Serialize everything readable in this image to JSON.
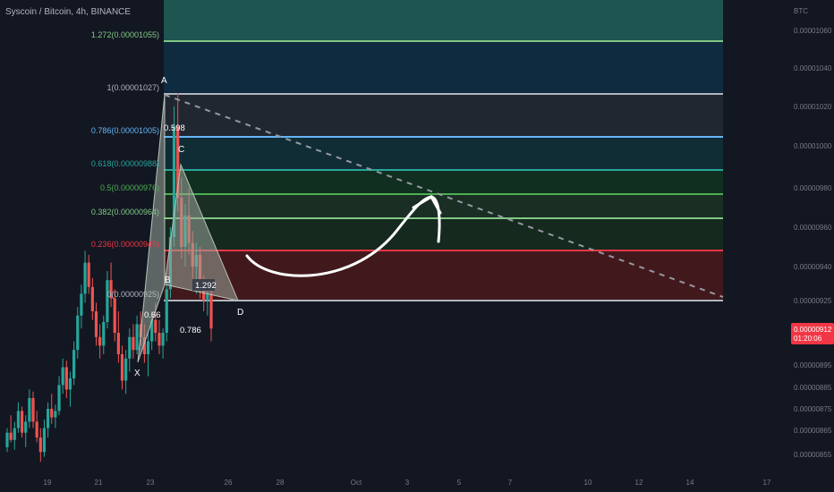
{
  "header": {
    "title": "Syscoin / Bitcoin, 4h, BINANCE"
  },
  "chart_data": {
    "type": "candlestick",
    "symbol": "Syscoin / Bitcoin",
    "interval": "4h",
    "exchange": "BINANCE",
    "currency": "BTC",
    "price_axis_ticks": [
      "0.00001060",
      "0.00001040",
      "0.00001020",
      "0.00001000",
      "0.00000980",
      "0.00000960",
      "0.00000940",
      "0.00000925",
      "0.00000895",
      "0.00000885",
      "0.00000875",
      "0.00000865",
      "0.00000855"
    ],
    "time_axis_ticks": [
      "19",
      "21",
      "23",
      "26",
      "28",
      "Oct",
      "3",
      "5",
      "7",
      "10",
      "12",
      "14",
      "17"
    ],
    "last_price": {
      "value": "0.00000912",
      "countdown": "01:20:06",
      "color": "#f23645"
    },
    "fibonacci": [
      {
        "ratio": "1.272",
        "price": "0.00001055",
        "color": "#81c784"
      },
      {
        "ratio": "1",
        "price": "0.00001027",
        "color": "#b2b5be"
      },
      {
        "ratio": "0.786",
        "price": "0.00001005",
        "color": "#64b5f6"
      },
      {
        "ratio": "0.618",
        "price": "0.00000988",
        "color": "#26a69a"
      },
      {
        "ratio": "0.5",
        "price": "0.00000976",
        "color": "#4caf50"
      },
      {
        "ratio": "0.382",
        "price": "0.00000964",
        "color": "#81c784"
      },
      {
        "ratio": "0.236",
        "price": "0.00000949",
        "color": "#f23645"
      },
      {
        "ratio": "0",
        "price": "0.00000925",
        "color": "#b2b5be"
      }
    ],
    "fib_labels": [
      "1.272(0.00001055)",
      "1(0.00001027)",
      "0.786(0.00001005)",
      "0.618(0.00000988)",
      "0.5(0.00000976)",
      "0.382(0.00000964)",
      "0.236(0.00000949)",
      "0(0.00000925)"
    ],
    "harmonic_pattern": {
      "points": [
        "X",
        "A",
        "B",
        "C",
        "D"
      ],
      "ratios": [
        "0.598",
        "0.66",
        "0.786",
        "1.292"
      ]
    },
    "candles": [
      [
        8.58e-06,
        8.66e-06,
        8.56e-06,
        8.64e-06
      ],
      [
        8.64e-06,
        8.72e-06,
        8.6e-06,
        8.61e-06
      ],
      [
        8.61e-06,
        8.69e-06,
        8.57e-06,
        8.66e-06
      ],
      [
        8.66e-06,
        8.78e-06,
        8.64e-06,
        8.74e-06
      ],
      [
        8.74e-06,
        8.76e-06,
        8.62e-06,
        8.64e-06
      ],
      [
        8.64e-06,
        8.72e-06,
        8.58e-06,
        8.69e-06
      ],
      [
        8.69e-06,
        8.84e-06,
        8.66e-06,
        8.8e-06
      ],
      [
        8.8e-06,
        8.83e-06,
        8.66e-06,
        8.69e-06
      ],
      [
        8.69e-06,
        8.74e-06,
        8.6e-06,
        8.62e-06
      ],
      [
        8.62e-06,
        8.66e-06,
        8.52e-06,
        8.56e-06
      ],
      [
        8.56e-06,
        8.7e-06,
        8.54e-06,
        8.66e-06
      ],
      [
        8.66e-06,
        8.78e-06,
        8.62e-06,
        8.75e-06
      ],
      [
        8.75e-06,
        8.82e-06,
        8.68e-06,
        8.71e-06
      ],
      [
        8.71e-06,
        8.77e-06,
        8.66e-06,
        8.74e-06
      ],
      [
        8.74e-06,
        8.9e-06,
        8.72e-06,
        8.86e-06
      ],
      [
        8.86e-06,
        8.98e-06,
        8.82e-06,
        8.94e-06
      ],
      [
        8.94e-06,
        8.97e-06,
        8.8e-06,
        8.84e-06
      ],
      [
        8.84e-06,
        8.92e-06,
        8.76e-06,
        8.89e-06
      ],
      [
        8.89e-06,
        9.06e-06,
        8.86e-06,
        9.02e-06
      ],
      [
        9.02e-06,
        9.22e-06,
        8.98e-06,
        9.18e-06
      ],
      [
        9.18e-06,
        9.32e-06,
        9.12e-06,
        9.28e-06
      ],
      [
        9.28e-06,
        9.48e-06,
        9.24e-06,
        9.42e-06
      ],
      [
        9.42e-06,
        9.46e-06,
        9.28e-06,
        9.31e-06
      ],
      [
        9.31e-06,
        9.35e-06,
        9.16e-06,
        9.2e-06
      ],
      [
        9.2e-06,
        9.24e-06,
        9.04e-06,
        9.08e-06
      ],
      [
        9.08e-06,
        9.14e-06,
        8.98e-06,
        9.04e-06
      ],
      [
        9.04e-06,
        9.18e-06,
        9e-06,
        9.15e-06
      ],
      [
        9.15e-06,
        9.38e-06,
        9.12e-06,
        9.34e-06
      ],
      [
        9.34e-06,
        9.42e-06,
        9.22e-06,
        9.26e-06
      ],
      [
        9.26e-06,
        9.3e-06,
        9.06e-06,
        9.1e-06
      ],
      [
        9.1e-06,
        9.2e-06,
        8.96e-06,
        9e-06
      ],
      [
        9e-06,
        9.04e-06,
        8.84e-06,
        8.88e-06
      ],
      [
        8.88e-06,
        9.02e-06,
        8.82e-06,
        8.98e-06
      ],
      [
        8.98e-06,
        9.12e-06,
        8.92e-06,
        9.08e-06
      ],
      [
        9.08e-06,
        9.14e-06,
        8.98e-06,
        9.02e-06
      ],
      [
        9.02e-06,
        9.18e-06,
        9e-06,
        9.14e-06
      ],
      [
        9.14e-06,
        9.2e-06,
        9.04e-06,
        9.08e-06
      ],
      [
        9.08e-06,
        9.14e-06,
        8.96e-06,
        9e-06
      ],
      [
        9e-06,
        9.1e-06,
        8.9e-06,
        9.06e-06
      ],
      [
        9.06e-06,
        9.2e-06,
        9.02e-06,
        9.16e-06
      ],
      [
        9.16e-06,
        9.24e-06,
        9.06e-06,
        9.1e-06
      ],
      [
        9.1e-06,
        9.16e-06,
        9e-06,
        9.04e-06
      ],
      [
        9.04e-06,
        9.12e-06,
        8.98e-06,
        9.1e-06
      ],
      [
        9.1e-06,
        9.34e-06,
        9.06e-06,
        9.3e-06
      ],
      [
        9.3e-06,
        9.6e-06,
        9.26e-06,
        9.55e-06
      ],
      [
        9.55e-06,
        1.02e-05,
        9.5e-06,
        1.01e-05
      ],
      [
        1.01e-05,
        1.027e-05,
        9.68e-06,
        9.75e-06
      ],
      [
        9.75e-06,
        9.85e-06,
        9.44e-06,
        9.5e-06
      ],
      [
        9.5e-06,
        9.72e-06,
        9.4e-06,
        9.66e-06
      ],
      [
        9.66e-06,
        9.8e-06,
        9.46e-06,
        9.52e-06
      ],
      [
        9.52e-06,
        9.58e-06,
        9.34e-06,
        9.4e-06
      ],
      [
        9.4e-06,
        9.52e-06,
        9.28e-06,
        9.46e-06
      ],
      [
        9.46e-06,
        9.5e-06,
        9.26e-06,
        9.3e-06
      ],
      [
        9.3e-06,
        9.36e-06,
        9.2e-06,
        9.25e-06
      ],
      [
        9.25e-06,
        9.32e-06,
        9.18e-06,
        9.28e-06
      ],
      [
        9.28e-06,
        9.31e-06,
        9.06e-06,
        9.12e-06
      ]
    ]
  }
}
